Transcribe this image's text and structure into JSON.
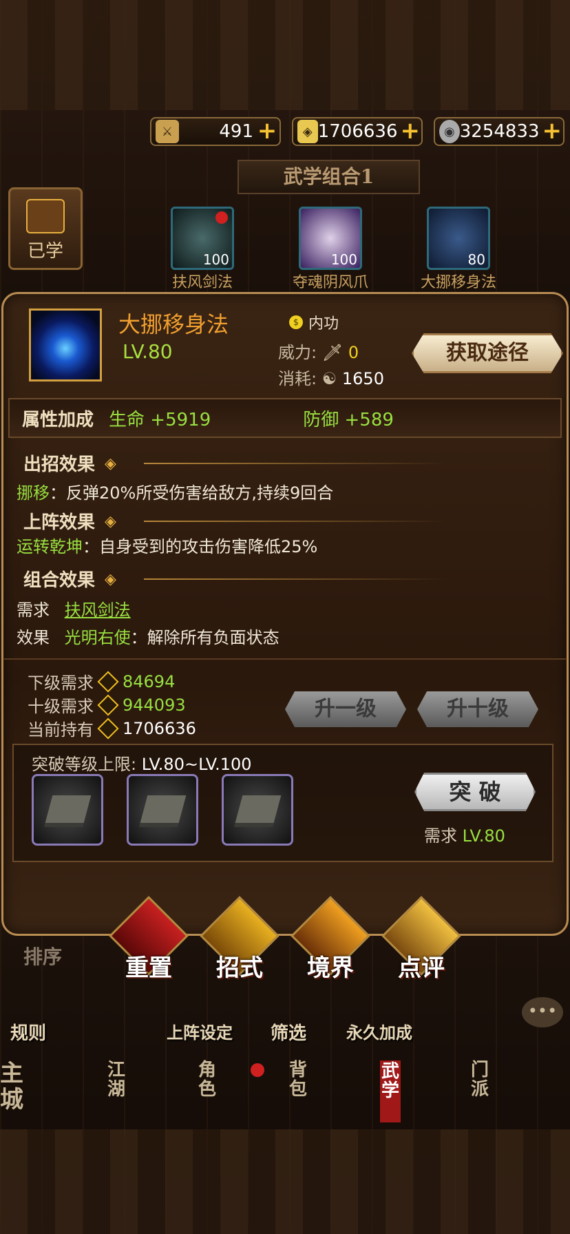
{
  "currency": [
    {
      "icon": "sword-ticket-icon",
      "value": "491"
    },
    {
      "icon": "gold-coin-icon",
      "value": "1706636"
    },
    {
      "icon": "silver-coin-icon",
      "value": "3254833"
    }
  ],
  "combo_title": "武学组合1",
  "learned_label": "已学",
  "combo_skills": [
    {
      "name": "扶风剑法",
      "level": "100"
    },
    {
      "name": "夺魂阴风爪",
      "level": "100"
    },
    {
      "name": "大挪移身法",
      "level": "80"
    }
  ],
  "skill": {
    "name": "大挪移身法",
    "level": "LV.80",
    "type": "内功",
    "power_label": "威力:",
    "power_value": "0",
    "cost_label": "消耗:",
    "cost_value": "1650",
    "obtain_button": "获取途径"
  },
  "attributes": {
    "label": "属性加成",
    "hp": "生命 +5919",
    "def": "防御 +589"
  },
  "sections": {
    "attack_title": "出招效果",
    "attack_name": "挪移",
    "attack_desc": "：反弹20%所受伤害给敌方,持续9回合",
    "deploy_title": "上阵效果",
    "deploy_name": "运转乾坤",
    "deploy_desc": "：自身受到的攻击伤害降低25%",
    "combo_title": "组合效果",
    "need_label": "需求",
    "need_value": "扶风剑法",
    "effect_label": "效果",
    "effect_name": "光明右使",
    "effect_desc": "：解除所有负面状态"
  },
  "upgrade": {
    "next_label": "下级需求",
    "next_value": "84694",
    "ten_label": "十级需求",
    "ten_value": "944093",
    "own_label": "当前持有",
    "own_value": "1706636",
    "up1": "升一级",
    "up10": "升十级"
  },
  "breakthrough": {
    "limit_label": "突破等级上限:",
    "limit_value": "LV.80~LV.100",
    "button": "突 破",
    "need_label": "需求",
    "need_value": "LV.80"
  },
  "actions": [
    "重置",
    "招式",
    "境界",
    "点评"
  ],
  "sort_label": "排序",
  "subnav": [
    "规则",
    "上阵设定",
    "筛选",
    "永久加成"
  ],
  "bottom_nav": [
    "主城",
    "江湖",
    "角色",
    "背包",
    "武学",
    "门派"
  ]
}
